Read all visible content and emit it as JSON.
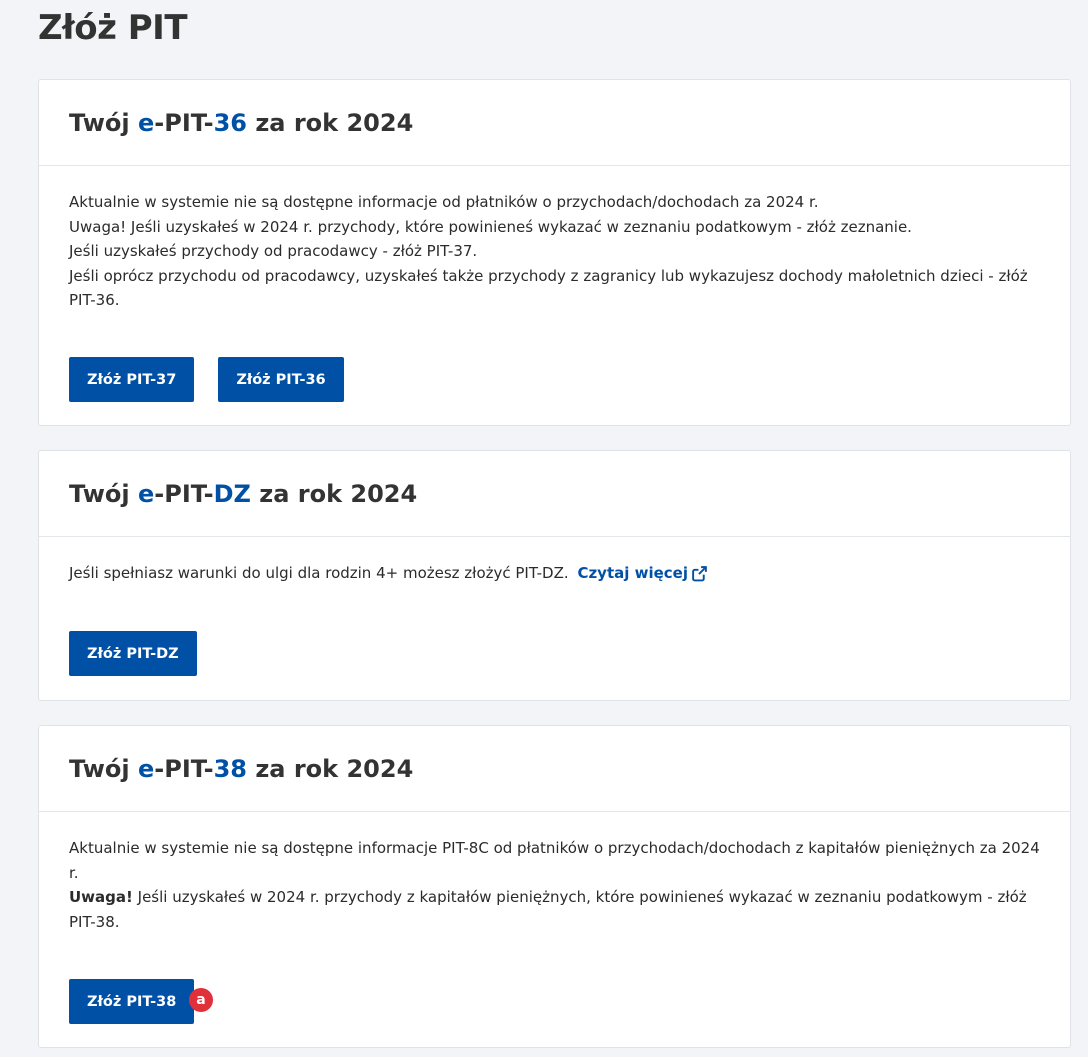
{
  "page": {
    "title": "Złóż PIT"
  },
  "cards": [
    {
      "title_prefix": "Twój ",
      "title_accent_1": "e",
      "title_mid": "-PIT-",
      "title_accent_2": "36",
      "title_suffix": " za rok 2024",
      "lines": [
        "Aktualnie w systemie nie są dostępne informacje od płatników o przychodach/dochodach za 2024 r.",
        "Uwaga! Jeśli uzyskałeś w 2024 r. przychody, które powinieneś wykazać w zeznaniu podatkowym - złóż zeznanie.",
        "Jeśli uzyskałeś przychody od pracodawcy - złóż PIT-37.",
        "Jeśli oprócz przychodu od pracodawcy, uzyskałeś także przychody z zagranicy lub wykazujesz dochody małoletnich dzieci - złóż PIT-36."
      ],
      "buttons": [
        "Złóż PIT-37",
        "Złóż PIT-36"
      ]
    },
    {
      "title_prefix": "Twój ",
      "title_accent_1": "e",
      "title_mid": "-PIT-",
      "title_accent_2": "DZ",
      "title_suffix": " za rok 2024",
      "text": "Jeśli spełniasz warunki do ulgi dla rodzin 4+ możesz złożyć PIT-DZ.",
      "link_label": "Czytaj więcej",
      "buttons": [
        "Złóż PIT-DZ"
      ]
    },
    {
      "title_prefix": "Twój ",
      "title_accent_1": "e",
      "title_mid": "-PIT-",
      "title_accent_2": "38",
      "title_suffix": " za rok 2024",
      "line1": "Aktualnie w systemie nie są dostępne informacje PIT-8C od płatników o przychodach/dochodach z kapitałów pieniężnych za 2024 r.",
      "line2_bold": "Uwaga!",
      "line2_rest": " Jeśli uzyskałeś w 2024 r. przychody z kapitałów pieniężnych, które powinieneś wykazać w zeznaniu podatkowym - złóż PIT-38.",
      "buttons": [
        "Złóż PIT-38"
      ]
    }
  ],
  "annotation": {
    "badge_label": "a"
  },
  "colors": {
    "accent": "#0051a5",
    "background": "#f2f4f7",
    "badge": "#e0313b"
  },
  "icons": {
    "external_link": "external-link-icon"
  }
}
